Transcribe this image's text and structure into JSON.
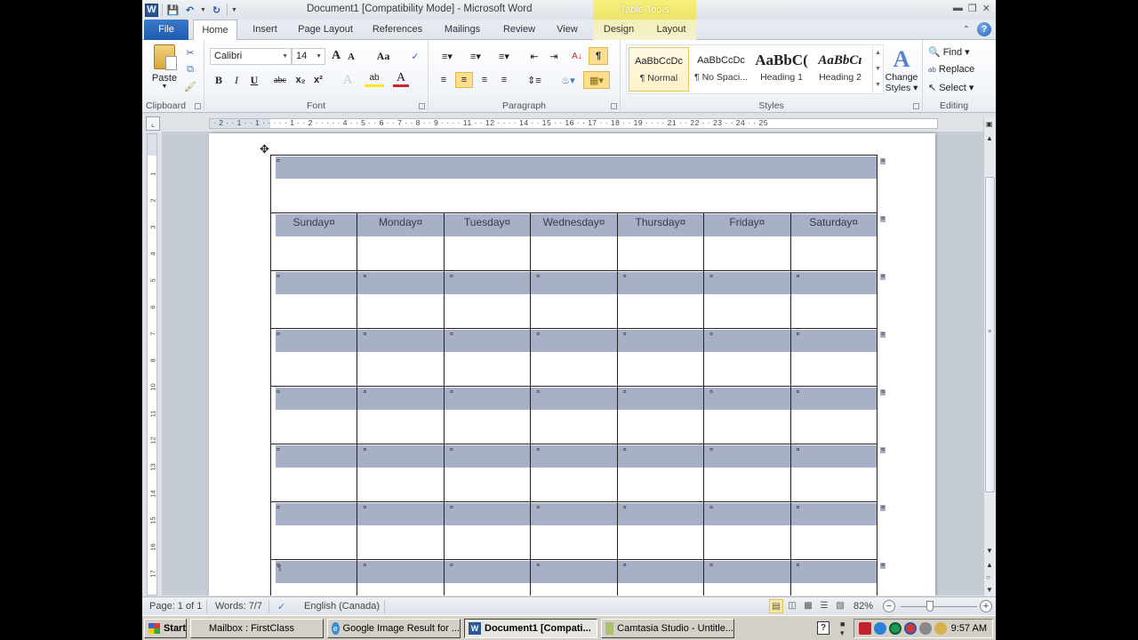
{
  "window": {
    "title": "Document1 [Compatibility Mode]  -  Microsoft Word",
    "contextual_tab_title": "Table Tools",
    "controls": [
      "minimize",
      "restore",
      "close"
    ]
  },
  "quick_access": {
    "app_icon": "W",
    "items": [
      "save-icon",
      "undo-icon",
      "redo-icon",
      "customize-icon"
    ]
  },
  "tabs": [
    {
      "label": "File",
      "active": false
    },
    {
      "label": "Home",
      "active": true
    },
    {
      "label": "Insert",
      "active": false
    },
    {
      "label": "Page Layout",
      "active": false
    },
    {
      "label": "References",
      "active": false
    },
    {
      "label": "Mailings",
      "active": false
    },
    {
      "label": "Review",
      "active": false
    },
    {
      "label": "View",
      "active": false
    },
    {
      "label": "Design",
      "active": false
    },
    {
      "label": "Layout",
      "active": false
    }
  ],
  "ribbon": {
    "clipboard": {
      "label": "Clipboard",
      "paste_label": "Paste"
    },
    "font": {
      "label": "Font",
      "font_name": "Calibri",
      "font_size": "14",
      "grow_font": "A",
      "shrink_font": "A",
      "change_case": "Aa",
      "bold": "B",
      "italic": "I",
      "underline": "U",
      "strikethrough": "abc",
      "subscript": "x₂",
      "superscript": "x²",
      "text_effects": "A",
      "highlight": "ab",
      "font_color": "A"
    },
    "paragraph": {
      "label": "Paragraph",
      "show_hide": "¶"
    },
    "styles": {
      "label": "Styles",
      "items": [
        {
          "preview": "AaBbCcDc",
          "name": "¶ Normal",
          "selected": true
        },
        {
          "preview": "AaBbCcDc",
          "name": "¶ No Spaci...",
          "selected": false
        },
        {
          "preview": "AaBbC(",
          "name": "Heading 1",
          "selected": false
        },
        {
          "preview": "AaBbCı",
          "name": "Heading 2",
          "selected": false
        }
      ],
      "change_styles_line1": "Change",
      "change_styles_line2": "Styles ▾"
    },
    "editing": {
      "label": "Editing",
      "find": "Find ▾",
      "replace": "Replace",
      "select": "Select ▾"
    }
  },
  "ruler": {
    "horizontal_text": "· 2 · · 1 · · 1 · · · · · 1 · · 2 · · · · · 4 · · 5 · · 6 · · 7 · · 8 · · 9 · · · · 11 · · 12 · · · · 14 · · 15 · · 16 · · 17 · · 18 · · 19 · · · · 21 · · 22 · · 23 · · 24 · · 25",
    "vertical_numbers": [
      "1",
      "2",
      "3",
      "4",
      "5",
      "6",
      "7",
      "8",
      "10",
      "11",
      "12",
      "13",
      "14",
      "15",
      "16",
      "17"
    ]
  },
  "document": {
    "title_row_mark": "¤",
    "days": [
      "Sunday¤",
      "Monday¤",
      "Tuesday¤",
      "Wednesday¤",
      "Thursday¤",
      "Friday¤",
      "Saturday¤"
    ],
    "week_rows": 6,
    "cell_mark": "¤",
    "row_end_mark": "¤",
    "paragraph_mark": "¶",
    "shade_color": "#a8b0c8"
  },
  "status_bar": {
    "page": "Page: 1 of 1",
    "words": "Words: 7/7",
    "language": "English (Canada)",
    "zoom": "82%",
    "zoom_minus": "−",
    "zoom_plus": "+"
  },
  "taskbar": {
    "start_label": "Start",
    "buttons": [
      {
        "label": "Mailbox : FirstClass",
        "active": false
      },
      {
        "label": "Google Image Result for ...",
        "active": false
      },
      {
        "label": "Document1 [Compati...",
        "active": true
      },
      {
        "label": "Camtasia Studio - Untitle...",
        "active": false
      }
    ],
    "clock": "9:57 AM"
  }
}
